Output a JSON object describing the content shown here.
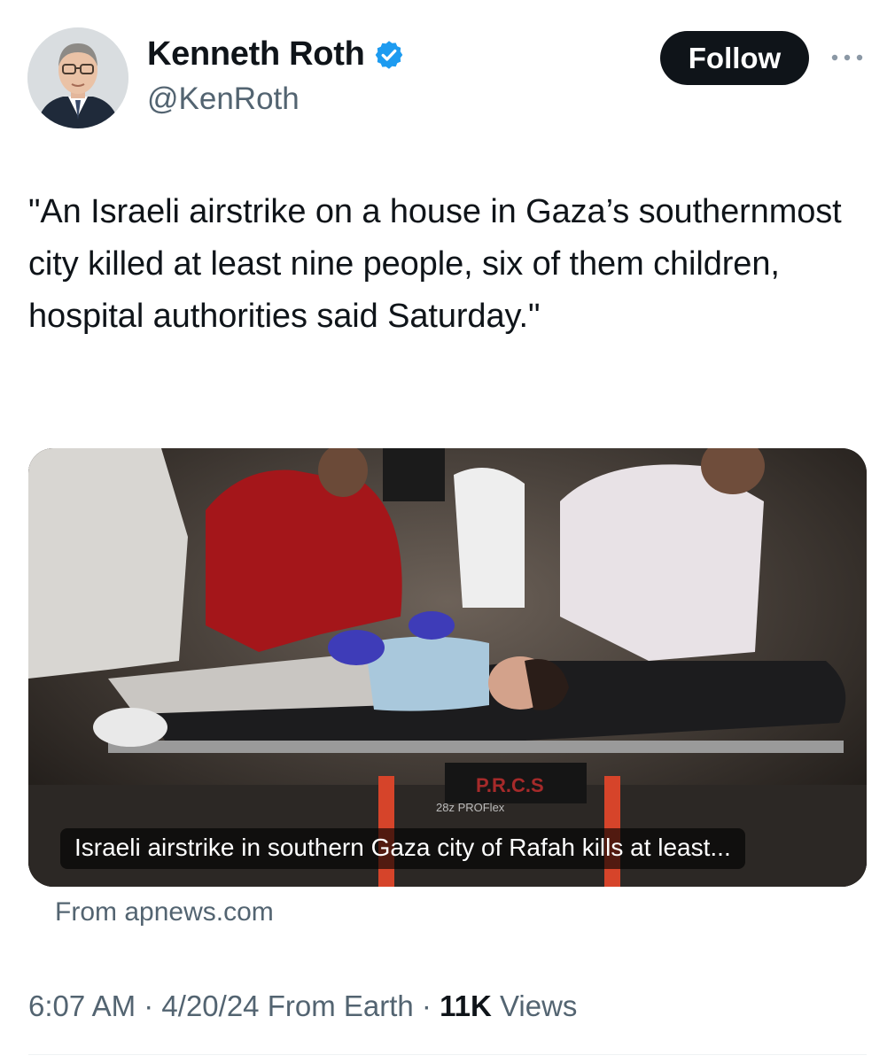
{
  "author": {
    "display_name": "Kenneth Roth",
    "handle": "@KenRoth",
    "verified": true,
    "verified_color": "#1d9bf0"
  },
  "actions": {
    "follow_label": "Follow",
    "more_icon": "more-horizontal-icon"
  },
  "tweet": {
    "text": "\"An Israeli airstrike on a house in Gaza’s southernmost city killed at least nine people, six of them children, hospital authorities said Saturday.\""
  },
  "card": {
    "caption": "Israeli airstrike in southern Gaza city of Rafah kills at least...",
    "source": "From apnews.com",
    "stretcher_text": "P.R.C.S",
    "stretcher_model": "28z PROFlex"
  },
  "meta": {
    "time": "6:07 AM",
    "date": "4/20/24",
    "location": "From Earth",
    "separator": "·",
    "views_count": "11K",
    "views_label": "Views"
  }
}
